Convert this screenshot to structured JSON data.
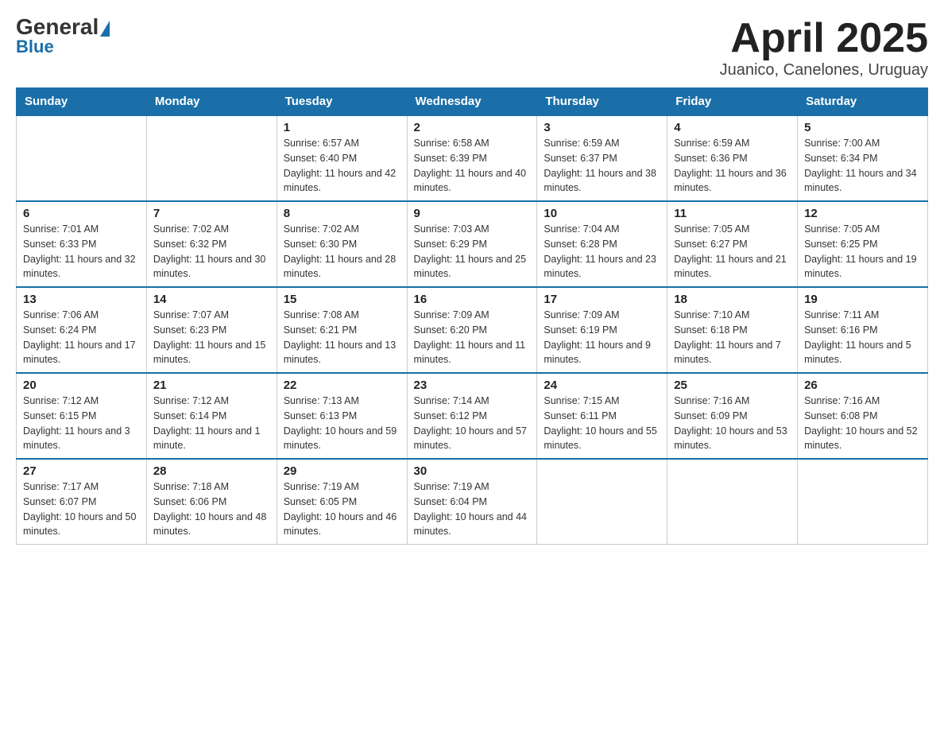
{
  "header": {
    "logo_general": "General",
    "logo_blue": "Blue",
    "title": "April 2025",
    "location": "Juanico, Canelones, Uruguay"
  },
  "days_of_week": [
    "Sunday",
    "Monday",
    "Tuesday",
    "Wednesday",
    "Thursday",
    "Friday",
    "Saturday"
  ],
  "weeks": [
    [
      {
        "day": "",
        "sunrise": "",
        "sunset": "",
        "daylight": ""
      },
      {
        "day": "",
        "sunrise": "",
        "sunset": "",
        "daylight": ""
      },
      {
        "day": "1",
        "sunrise": "Sunrise: 6:57 AM",
        "sunset": "Sunset: 6:40 PM",
        "daylight": "Daylight: 11 hours and 42 minutes."
      },
      {
        "day": "2",
        "sunrise": "Sunrise: 6:58 AM",
        "sunset": "Sunset: 6:39 PM",
        "daylight": "Daylight: 11 hours and 40 minutes."
      },
      {
        "day": "3",
        "sunrise": "Sunrise: 6:59 AM",
        "sunset": "Sunset: 6:37 PM",
        "daylight": "Daylight: 11 hours and 38 minutes."
      },
      {
        "day": "4",
        "sunrise": "Sunrise: 6:59 AM",
        "sunset": "Sunset: 6:36 PM",
        "daylight": "Daylight: 11 hours and 36 minutes."
      },
      {
        "day": "5",
        "sunrise": "Sunrise: 7:00 AM",
        "sunset": "Sunset: 6:34 PM",
        "daylight": "Daylight: 11 hours and 34 minutes."
      }
    ],
    [
      {
        "day": "6",
        "sunrise": "Sunrise: 7:01 AM",
        "sunset": "Sunset: 6:33 PM",
        "daylight": "Daylight: 11 hours and 32 minutes."
      },
      {
        "day": "7",
        "sunrise": "Sunrise: 7:02 AM",
        "sunset": "Sunset: 6:32 PM",
        "daylight": "Daylight: 11 hours and 30 minutes."
      },
      {
        "day": "8",
        "sunrise": "Sunrise: 7:02 AM",
        "sunset": "Sunset: 6:30 PM",
        "daylight": "Daylight: 11 hours and 28 minutes."
      },
      {
        "day": "9",
        "sunrise": "Sunrise: 7:03 AM",
        "sunset": "Sunset: 6:29 PM",
        "daylight": "Daylight: 11 hours and 25 minutes."
      },
      {
        "day": "10",
        "sunrise": "Sunrise: 7:04 AM",
        "sunset": "Sunset: 6:28 PM",
        "daylight": "Daylight: 11 hours and 23 minutes."
      },
      {
        "day": "11",
        "sunrise": "Sunrise: 7:05 AM",
        "sunset": "Sunset: 6:27 PM",
        "daylight": "Daylight: 11 hours and 21 minutes."
      },
      {
        "day": "12",
        "sunrise": "Sunrise: 7:05 AM",
        "sunset": "Sunset: 6:25 PM",
        "daylight": "Daylight: 11 hours and 19 minutes."
      }
    ],
    [
      {
        "day": "13",
        "sunrise": "Sunrise: 7:06 AM",
        "sunset": "Sunset: 6:24 PM",
        "daylight": "Daylight: 11 hours and 17 minutes."
      },
      {
        "day": "14",
        "sunrise": "Sunrise: 7:07 AM",
        "sunset": "Sunset: 6:23 PM",
        "daylight": "Daylight: 11 hours and 15 minutes."
      },
      {
        "day": "15",
        "sunrise": "Sunrise: 7:08 AM",
        "sunset": "Sunset: 6:21 PM",
        "daylight": "Daylight: 11 hours and 13 minutes."
      },
      {
        "day": "16",
        "sunrise": "Sunrise: 7:09 AM",
        "sunset": "Sunset: 6:20 PM",
        "daylight": "Daylight: 11 hours and 11 minutes."
      },
      {
        "day": "17",
        "sunrise": "Sunrise: 7:09 AM",
        "sunset": "Sunset: 6:19 PM",
        "daylight": "Daylight: 11 hours and 9 minutes."
      },
      {
        "day": "18",
        "sunrise": "Sunrise: 7:10 AM",
        "sunset": "Sunset: 6:18 PM",
        "daylight": "Daylight: 11 hours and 7 minutes."
      },
      {
        "day": "19",
        "sunrise": "Sunrise: 7:11 AM",
        "sunset": "Sunset: 6:16 PM",
        "daylight": "Daylight: 11 hours and 5 minutes."
      }
    ],
    [
      {
        "day": "20",
        "sunrise": "Sunrise: 7:12 AM",
        "sunset": "Sunset: 6:15 PM",
        "daylight": "Daylight: 11 hours and 3 minutes."
      },
      {
        "day": "21",
        "sunrise": "Sunrise: 7:12 AM",
        "sunset": "Sunset: 6:14 PM",
        "daylight": "Daylight: 11 hours and 1 minute."
      },
      {
        "day": "22",
        "sunrise": "Sunrise: 7:13 AM",
        "sunset": "Sunset: 6:13 PM",
        "daylight": "Daylight: 10 hours and 59 minutes."
      },
      {
        "day": "23",
        "sunrise": "Sunrise: 7:14 AM",
        "sunset": "Sunset: 6:12 PM",
        "daylight": "Daylight: 10 hours and 57 minutes."
      },
      {
        "day": "24",
        "sunrise": "Sunrise: 7:15 AM",
        "sunset": "Sunset: 6:11 PM",
        "daylight": "Daylight: 10 hours and 55 minutes."
      },
      {
        "day": "25",
        "sunrise": "Sunrise: 7:16 AM",
        "sunset": "Sunset: 6:09 PM",
        "daylight": "Daylight: 10 hours and 53 minutes."
      },
      {
        "day": "26",
        "sunrise": "Sunrise: 7:16 AM",
        "sunset": "Sunset: 6:08 PM",
        "daylight": "Daylight: 10 hours and 52 minutes."
      }
    ],
    [
      {
        "day": "27",
        "sunrise": "Sunrise: 7:17 AM",
        "sunset": "Sunset: 6:07 PM",
        "daylight": "Daylight: 10 hours and 50 minutes."
      },
      {
        "day": "28",
        "sunrise": "Sunrise: 7:18 AM",
        "sunset": "Sunset: 6:06 PM",
        "daylight": "Daylight: 10 hours and 48 minutes."
      },
      {
        "day": "29",
        "sunrise": "Sunrise: 7:19 AM",
        "sunset": "Sunset: 6:05 PM",
        "daylight": "Daylight: 10 hours and 46 minutes."
      },
      {
        "day": "30",
        "sunrise": "Sunrise: 7:19 AM",
        "sunset": "Sunset: 6:04 PM",
        "daylight": "Daylight: 10 hours and 44 minutes."
      },
      {
        "day": "",
        "sunrise": "",
        "sunset": "",
        "daylight": ""
      },
      {
        "day": "",
        "sunrise": "",
        "sunset": "",
        "daylight": ""
      },
      {
        "day": "",
        "sunrise": "",
        "sunset": "",
        "daylight": ""
      }
    ]
  ]
}
